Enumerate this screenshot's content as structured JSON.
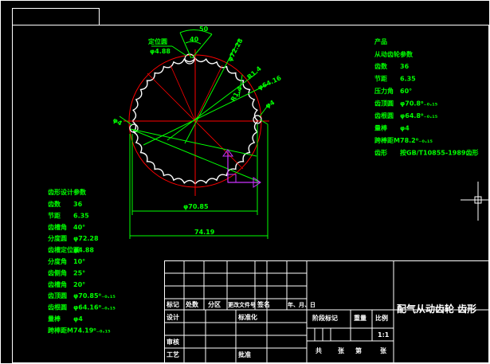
{
  "colors": {
    "background": "#000000",
    "frame": "#ffffff",
    "dimension": "#00ff00",
    "center_line": "#ff0000",
    "ucs_icon": "#cc33ff"
  },
  "icons": [
    "crosshair-cursor-icon",
    "ucs-axis-icon",
    "gear-tooth-profile"
  ],
  "dims": {
    "angle_50": "50",
    "angle_40": "40",
    "r72": "φ72.28",
    "ball_label": "定位圆",
    "ball_dia": "φ4.88",
    "r1_4_a": "R1.4",
    "r1_4_b": "R1.4",
    "d64": "φ64.16",
    "d4_right": "φ4",
    "d4_left": "φ4",
    "d70": "φ70.85",
    "d74": "74.19"
  },
  "product_table": {
    "heading": "产品",
    "subheading": "从动齿轮参数",
    "rows": [
      {
        "k": "齿数",
        "v": "36"
      },
      {
        "k": "节距",
        "v": "6.35"
      },
      {
        "k": "压力角",
        "v": "60°"
      },
      {
        "k": "齿顶圆",
        "v": "φ70.8⁰₋₀.₁₅"
      },
      {
        "k": "齿根圆",
        "v": "φ64.8⁰₋₀.₁₅"
      },
      {
        "k": "量棒",
        "v": "φ4"
      },
      {
        "k": "跨棒距M",
        "v": "78.2⁰₋₀.₁₅"
      },
      {
        "k": "齿形",
        "v": "按GB/T10855-1989齿形"
      }
    ]
  },
  "left_table": {
    "heading": "齿形设计参数",
    "rows": [
      {
        "k": "齿数",
        "v": "36"
      },
      {
        "k": "节距",
        "v": "6.35"
      },
      {
        "k": "齿槽角",
        "v": "40°"
      },
      {
        "k": "分度圆",
        "v": "φ72.28"
      },
      {
        "k": "齿槽定位圆",
        "v": "φ4.88"
      },
      {
        "k": "分度角",
        "v": "10°"
      },
      {
        "k": "齿侧角",
        "v": "25°"
      },
      {
        "k": "齿槽角",
        "v": "20°"
      },
      {
        "k": "齿顶圆",
        "v": "φ70.85⁰₋₀.₁₅"
      },
      {
        "k": "齿根圆",
        "v": "φ64.16⁰₋₀.₁₅"
      },
      {
        "k": "量棒",
        "v": "φ4"
      },
      {
        "k": "跨棒距M",
        "v": "74.19⁰₋₀.₁₅"
      }
    ]
  },
  "title_block": {
    "hdr_mark": "标记",
    "hdr_count": "处数",
    "hdr_zone": "分区",
    "hdr_changefile": "更改文件号",
    "hdr_sign": "签名",
    "hdr_date": "年、月、日",
    "row_design": "设计",
    "row_standard": "标准化",
    "row_review": "审核",
    "row_process": "工艺",
    "row_approve": "批准",
    "stage_mark": "阶段标记",
    "weight": "重量",
    "scale": "比例",
    "scale_value": "1:1",
    "sheets_total": "共",
    "sheets_total_unit": "张",
    "sheet_no": "第",
    "sheet_no_unit": "张",
    "drawing_title": "配气从动齿轮 齿形"
  }
}
